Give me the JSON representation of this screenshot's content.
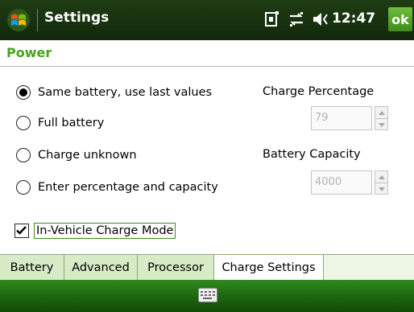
{
  "titlebar": {
    "title": "Settings",
    "time": "12:47",
    "ok_label": "ok"
  },
  "page": {
    "heading": "Power"
  },
  "options": [
    {
      "label": "Same battery, use last values",
      "selected": true
    },
    {
      "label": "Full battery",
      "selected": false
    },
    {
      "label": "Charge unknown",
      "selected": false
    },
    {
      "label": "Enter percentage and capacity",
      "selected": false
    }
  ],
  "charge": {
    "label": "Charge Percentage",
    "value": "79"
  },
  "capacity": {
    "label": "Battery Capacity",
    "value": "4000"
  },
  "vehicle_mode": {
    "label": "In-Vehicle Charge Mode",
    "checked": true
  },
  "tabs": [
    {
      "label": "Battery",
      "active": false
    },
    {
      "label": "Advanced",
      "active": false
    },
    {
      "label": "Processor",
      "active": false
    },
    {
      "label": "Charge Settings",
      "active": true
    }
  ],
  "colors": {
    "accent": "#47a31c",
    "titlebar": "#1f3d14",
    "ok": "#4f9f26"
  }
}
